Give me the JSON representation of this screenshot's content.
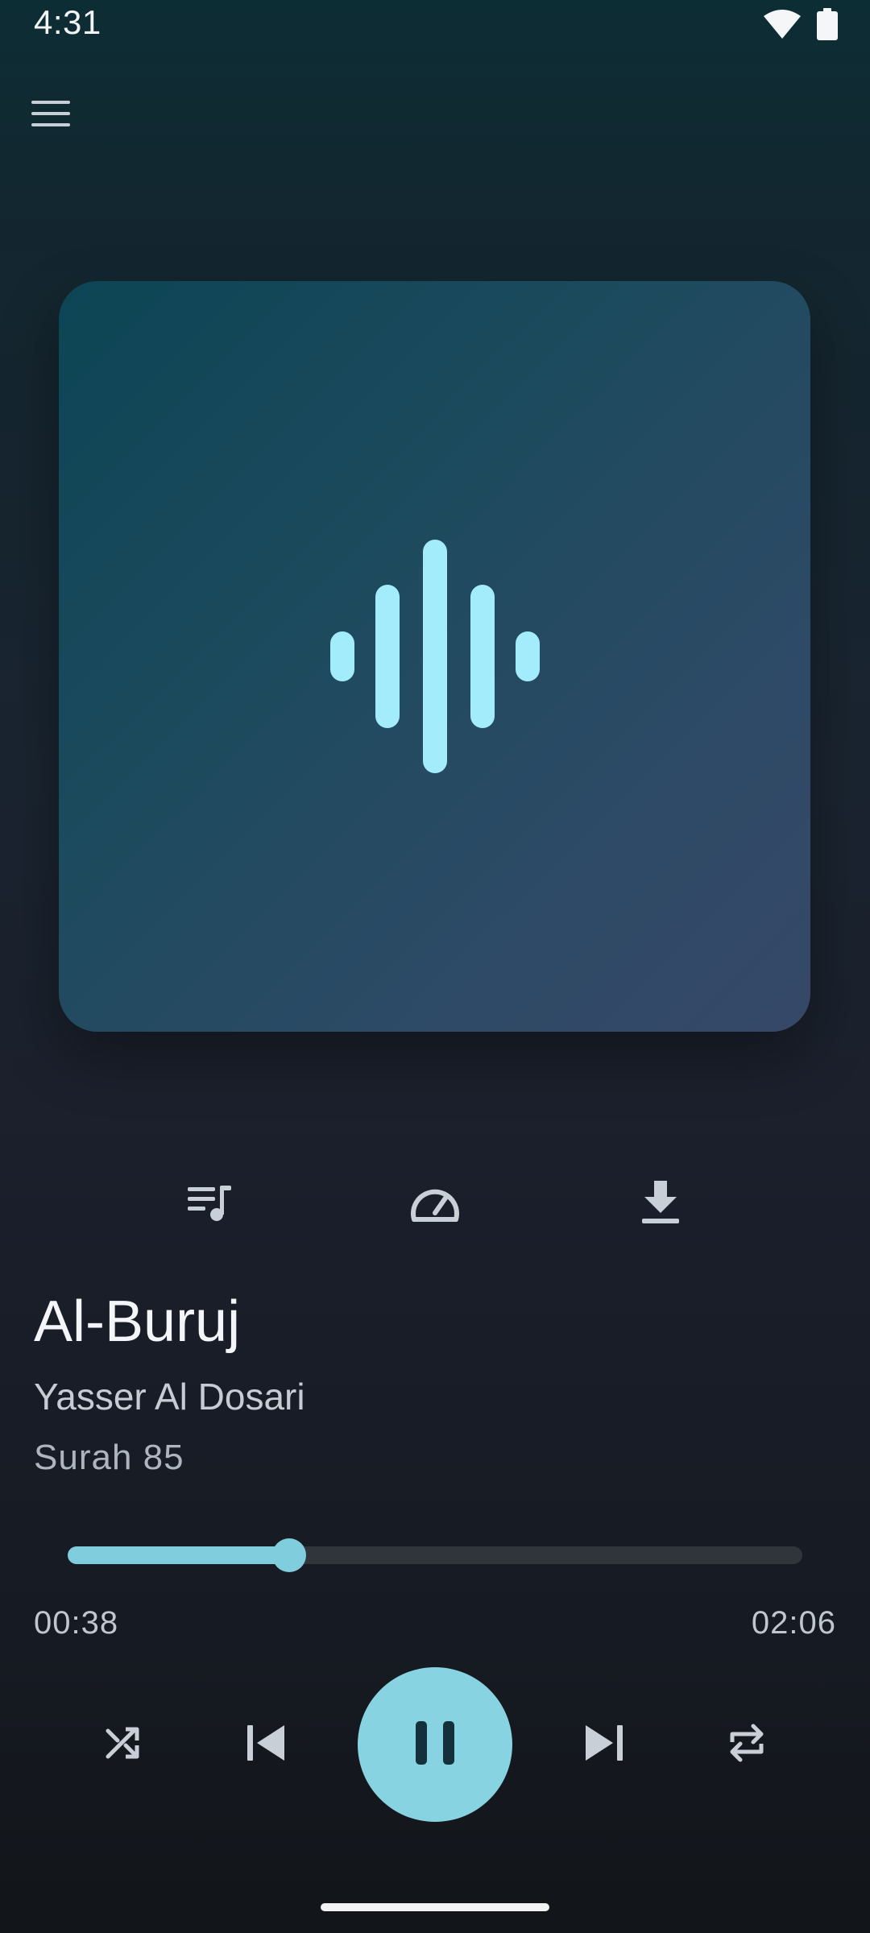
{
  "status_bar": {
    "time": "4:31",
    "icons": [
      "wifi-icon",
      "battery-icon"
    ]
  },
  "header": {
    "menu_icon": "menu-icon"
  },
  "artwork": {
    "icon": "waveform-icon",
    "accent_color": "#a3ecfb"
  },
  "actions": [
    {
      "name": "playlist-icon"
    },
    {
      "name": "speed-gauge-icon"
    },
    {
      "name": "download-icon"
    }
  ],
  "track": {
    "title": "Al-Buruj",
    "artist": "Yasser Al Dosari",
    "subtitle": "Surah 85"
  },
  "progress": {
    "elapsed": "00:38",
    "total": "02:06",
    "fraction": 0.302
  },
  "controls": {
    "shuffle": "shuffle-icon",
    "previous": "skip-previous-icon",
    "play_pause": "pause-icon",
    "next": "skip-next-icon",
    "repeat": "repeat-icon"
  },
  "colors": {
    "accent": "#87d3e1",
    "progress_fill": "#7fcddd",
    "progress_track": "#30343b"
  }
}
